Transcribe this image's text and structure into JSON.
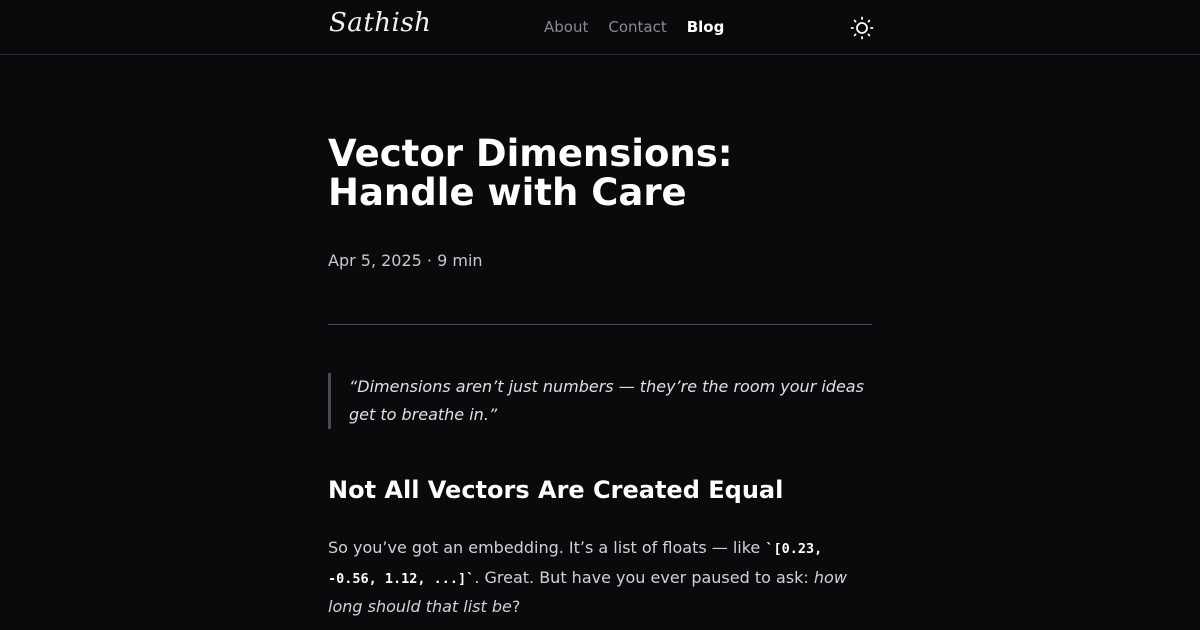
{
  "header": {
    "logo": "Sathish",
    "nav": [
      {
        "label": "About",
        "active": false
      },
      {
        "label": "Contact",
        "active": false
      },
      {
        "label": "Blog",
        "active": true
      }
    ],
    "theme_toggle_icon": "sun-icon"
  },
  "article": {
    "title": "Vector Dimensions: Handle with Care",
    "meta": "Apr 5, 2025 · 9 min",
    "quote": "“Dimensions aren’t just numbers — they’re the room your ideas get to breathe in.”",
    "heading": "Not All Vectors Are Created Equal",
    "paragraph": {
      "part1": "So you’ve got an embedding. It’s a list of floats — like ",
      "code": "`[0.23, -0.56, 1.12, ...]`",
      "part2": ". Great. But have you ever paused to ask: ",
      "emphasis": "how long should that list be",
      "part3": "?"
    }
  },
  "colors": {
    "background": "#0a0a0c",
    "text": "#ededed",
    "muted": "#8a8a90",
    "divider": "#4a4a50"
  }
}
